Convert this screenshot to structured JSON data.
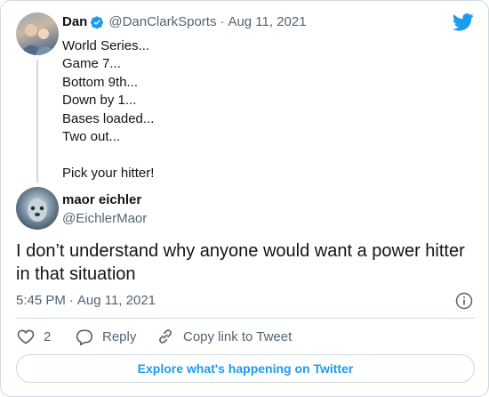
{
  "colors": {
    "twitter_blue": "#1d9bf0",
    "text": "#0f1419",
    "muted": "#536471",
    "border": "#cfd9de"
  },
  "parent_tweet": {
    "author_name": "Dan",
    "handle": "@DanClarkSports",
    "separator": "·",
    "date": "Aug 11, 2021",
    "lines": [
      "World Series...",
      "Game 7...",
      "Bottom 9th...",
      "Down by 1...",
      "Bases loaded...",
      "Two out...",
      "",
      "Pick your hitter!"
    ]
  },
  "reply_tweet": {
    "author_name": "maor eichler",
    "handle": "@EichlerMaor",
    "text": "I don’t understand why anyone would want a power hitter in that situation",
    "time": "5:45 PM",
    "separator": "·",
    "date": "Aug 11, 2021"
  },
  "actions": {
    "like_count": "2",
    "reply_label": "Reply",
    "copy_link_label": "Copy link to Tweet"
  },
  "explore_label": "Explore what's happening on Twitter",
  "icons": [
    "twitter-bird-icon",
    "verified-badge-icon",
    "info-icon",
    "heart-icon",
    "reply-bubble-icon",
    "link-icon"
  ]
}
